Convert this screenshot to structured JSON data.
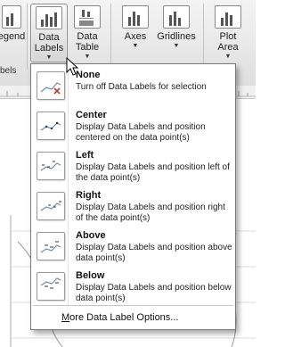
{
  "ribbon": {
    "legend_label": "egend",
    "data_labels_label": "Data\nLabels",
    "data_table_label": "Data\nTable",
    "axes_label": "Axes",
    "gridlines_label": "Gridlines",
    "plot_area_label": "Plot\nArea",
    "group_label": "bels"
  },
  "menu": {
    "items": [
      {
        "title": "None",
        "description": "Turn off Data Labels for selection",
        "icon": "data-labels-none-icon"
      },
      {
        "title": "Center",
        "description": "Display Data Labels and position centered on the data point(s)",
        "icon": "data-labels-center-icon"
      },
      {
        "title": "Left",
        "description": "Display Data Labels and position left of the data point(s)",
        "icon": "data-labels-left-icon"
      },
      {
        "title": "Right",
        "description": "Display Data Labels and position right of the data point(s)",
        "icon": "data-labels-right-icon"
      },
      {
        "title": "Above",
        "description": "Display Data Labels and position above data point(s)",
        "icon": "data-labels-above-icon"
      },
      {
        "title": "Below",
        "description": "Display Data Labels and position below data point(s)",
        "icon": "data-labels-below-icon"
      }
    ],
    "more_options": "More Data Label Options..."
  },
  "colors": {
    "ribbon_top": "#f4f4f4",
    "ribbon_bottom": "#dedede",
    "menu_border": "#7c7c7c"
  }
}
